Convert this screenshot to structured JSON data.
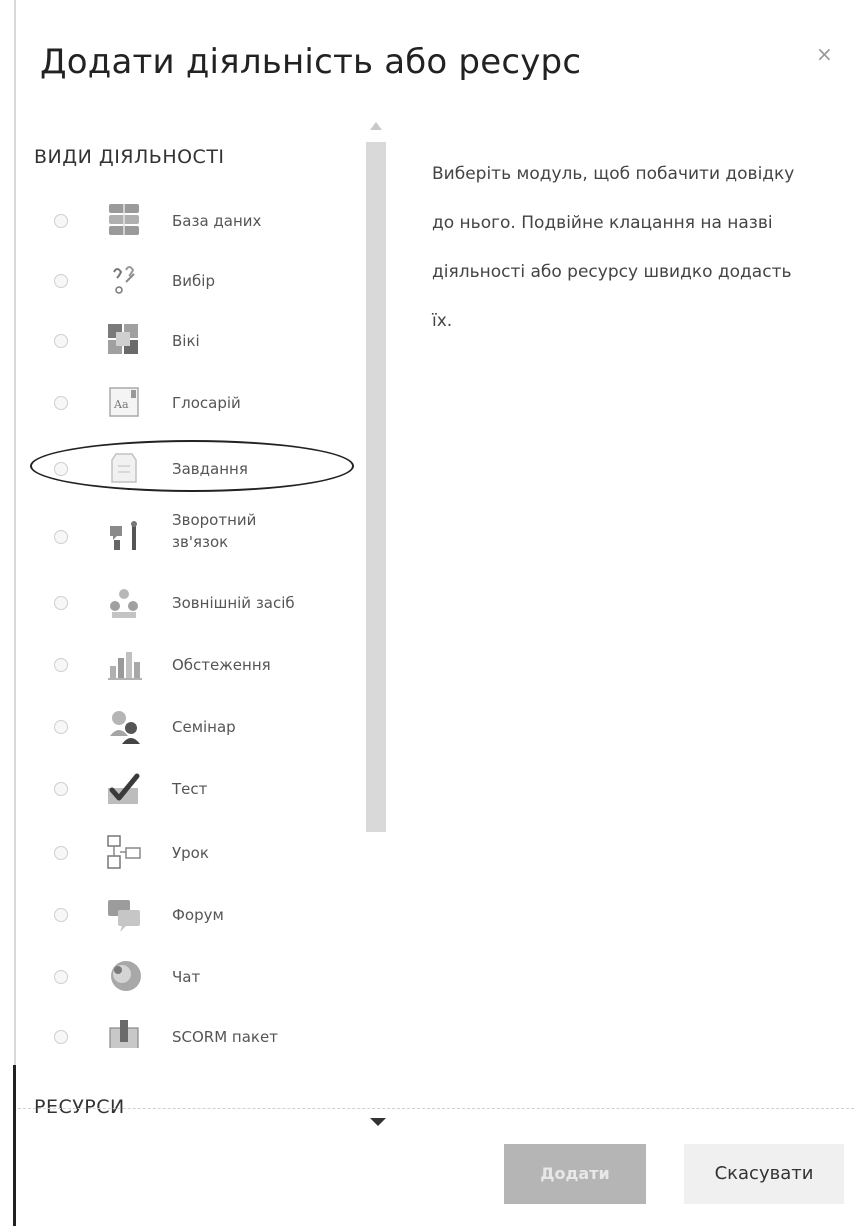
{
  "dialog": {
    "title": "Додати діяльність або ресурс",
    "close_label": "×"
  },
  "sections": {
    "activities_heading": "ВИДИ ДІЯЛЬНОСТІ",
    "resources_heading": "РЕСУРСИ"
  },
  "activities": [
    {
      "label": "База даних",
      "icon": "database-icon"
    },
    {
      "label": "Вибір",
      "icon": "choice-icon"
    },
    {
      "label": "Вікі",
      "icon": "wiki-icon"
    },
    {
      "label": "Глосарій",
      "icon": "glossary-icon"
    },
    {
      "label": "Завдання",
      "icon": "assignment-icon"
    },
    {
      "label": "Зворотний зв'язок",
      "icon": "feedback-icon"
    },
    {
      "label": "Зовнішній засіб",
      "icon": "external-tool-icon"
    },
    {
      "label": "Обстеження",
      "icon": "survey-icon"
    },
    {
      "label": "Семінар",
      "icon": "workshop-icon"
    },
    {
      "label": "Тест",
      "icon": "quiz-icon"
    },
    {
      "label": "Урок",
      "icon": "lesson-icon"
    },
    {
      "label": "Форум",
      "icon": "forum-icon"
    },
    {
      "label": "Чат",
      "icon": "chat-icon"
    },
    {
      "label": "SCORM пакет",
      "icon": "scorm-icon"
    }
  ],
  "help": {
    "text": "Виберіть модуль, щоб побачити довідку до нього. Подвійне клацання на назві діяльності або ресурсу швидко додасть їх."
  },
  "footer": {
    "add_label": "Додати",
    "cancel_label": "Скасувати"
  },
  "colors": {
    "add_button_bg": "#b5b5b5",
    "cancel_button_bg": "#f0f0f0",
    "scroll_track": "#d9d9d9"
  }
}
